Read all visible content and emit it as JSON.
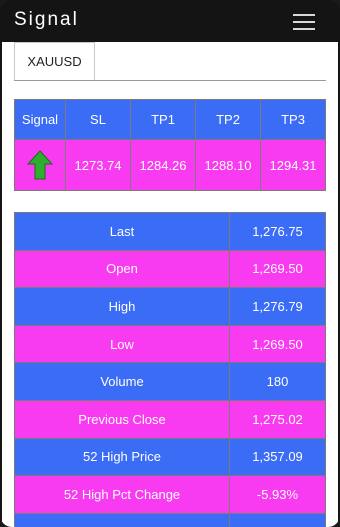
{
  "app": {
    "title": "Signal"
  },
  "icons": {
    "menu": "hamburger-icon",
    "signal": "green-up-arrow-icon"
  },
  "colors": {
    "blue": "#3a6cf5",
    "pink": "#f83af0",
    "arrow": "#2eae2e"
  },
  "tabs": [
    {
      "label": "XAUUSD"
    }
  ],
  "signal_table": {
    "headers": [
      "Signal",
      "SL",
      "TP1",
      "TP2",
      "TP3"
    ],
    "direction": "up",
    "sl": "1273.74",
    "tp1": "1284.26",
    "tp2": "1288.10",
    "tp3": "1294.31"
  },
  "info_rows": [
    {
      "label": "Last",
      "value": "1,276.75"
    },
    {
      "label": "Open",
      "value": "1,269.50"
    },
    {
      "label": "High",
      "value": "1,276.79"
    },
    {
      "label": "Low",
      "value": "1,269.50"
    },
    {
      "label": "Volume",
      "value": "180"
    },
    {
      "label": "Previous Close",
      "value": "1,275.02"
    },
    {
      "label": "52 High Price",
      "value": "1,357.09"
    },
    {
      "label": "52 High Pct Change",
      "value": "-5.93%"
    },
    {
      "label": "",
      "value": ""
    }
  ]
}
